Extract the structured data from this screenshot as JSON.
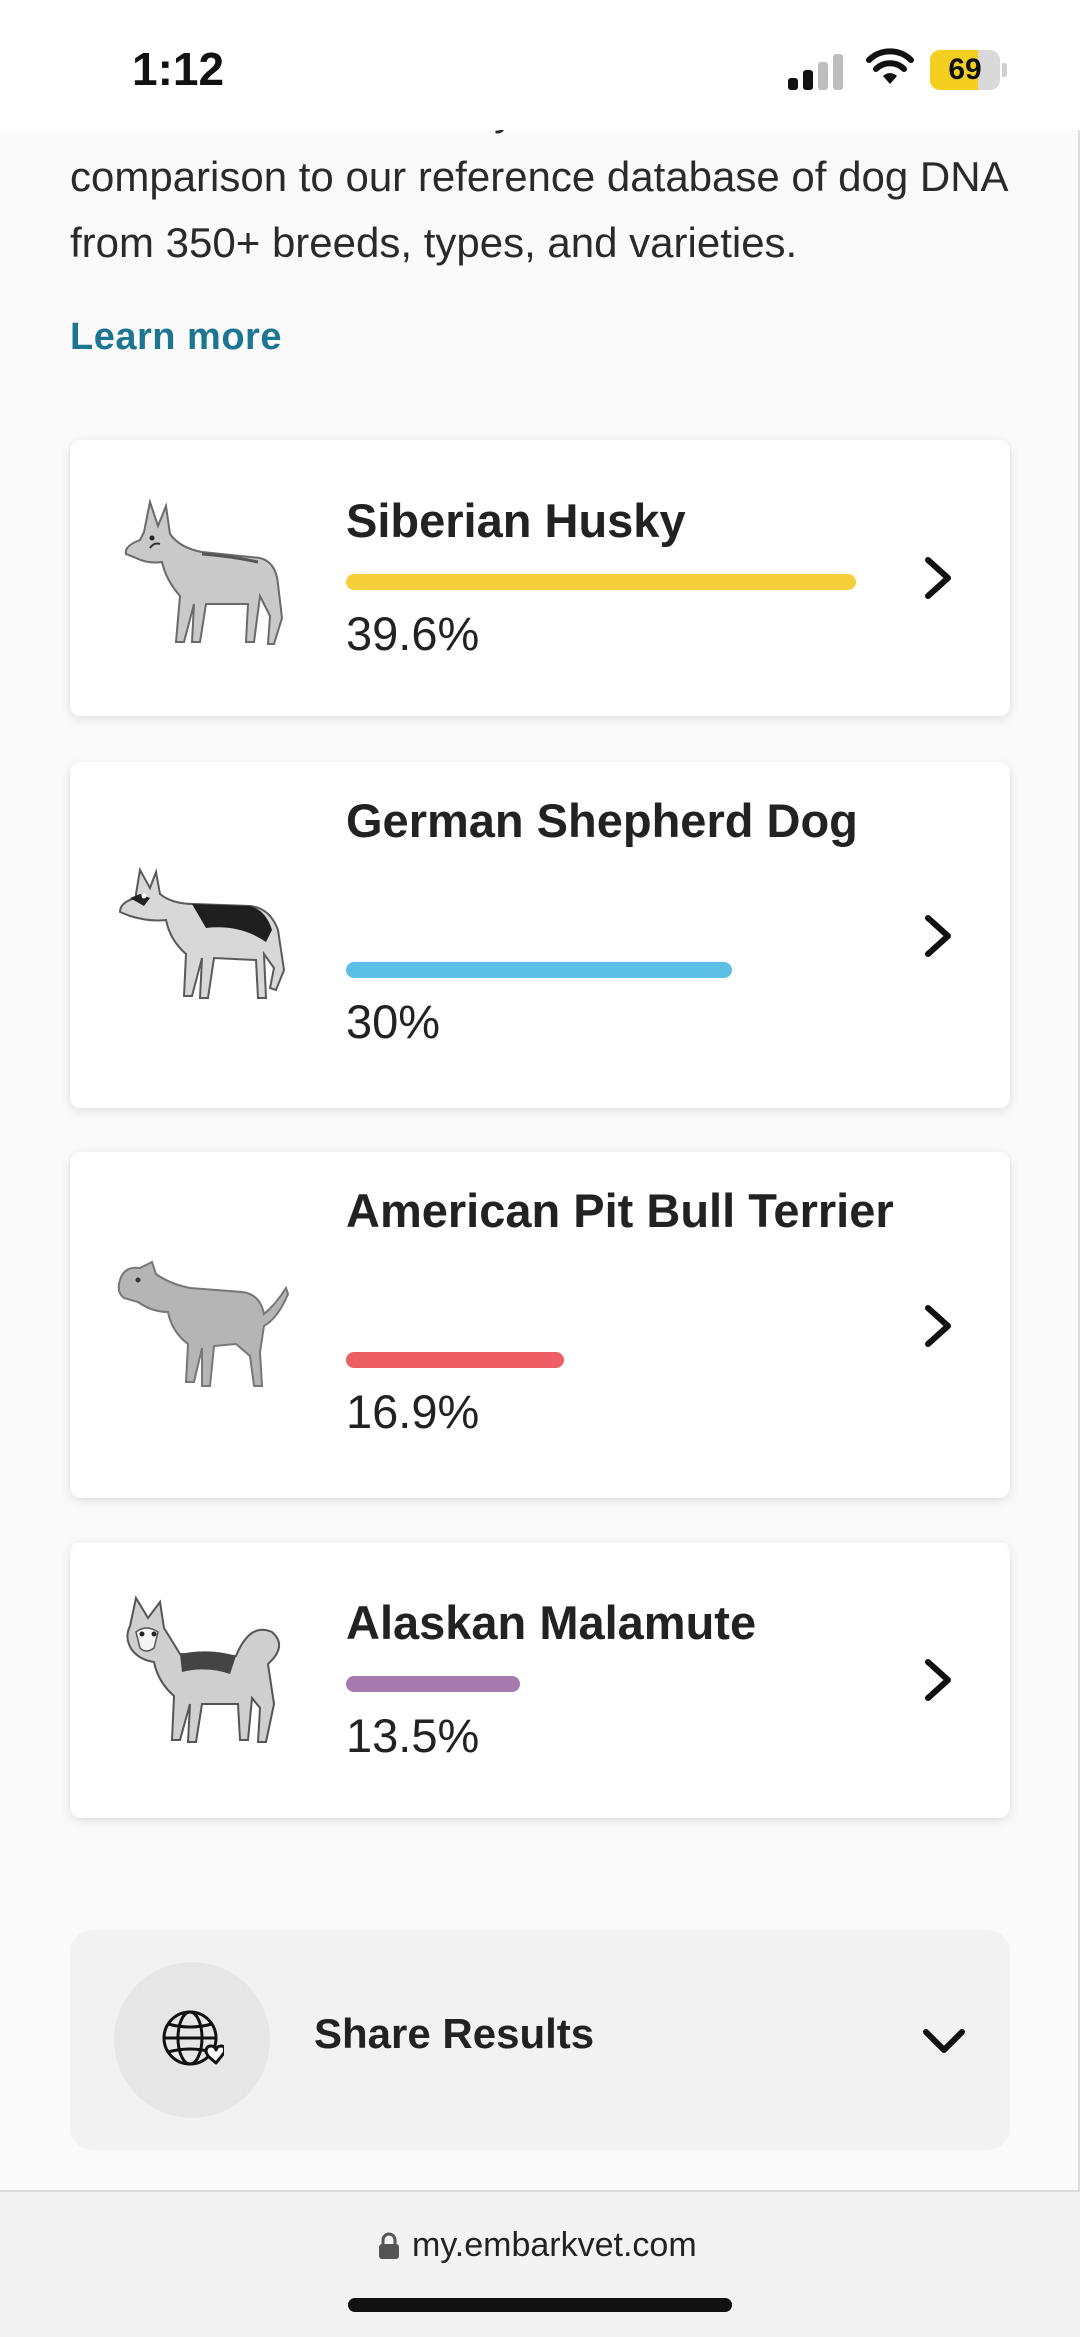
{
  "status_bar": {
    "time": "1:12",
    "battery_level": "69",
    "battery_fraction": 0.69
  },
  "intro": {
    "text": "Nala’s DNA breed analysis is based on a comparison to our reference database of dog DNA from 350+ breeds, types, and varieties.",
    "learn_more": "Learn more"
  },
  "breeds": [
    {
      "name": "Siberian Husky",
      "percent_label": "39.6%",
      "percent": 39.6,
      "color": "#f5cf3a",
      "icon": "husky-illustration"
    },
    {
      "name": "German Shepherd Dog",
      "percent_label": "30%",
      "percent": 30,
      "color": "#5bbfe6",
      "icon": "german-shepherd-illustration"
    },
    {
      "name": "American Pit Bull Terrier",
      "percent_label": "16.9%",
      "percent": 16.9,
      "color": "#ee5f63",
      "icon": "pit-bull-illustration"
    },
    {
      "name": "Alaskan Malamute",
      "percent_label": "13.5%",
      "percent": 13.5,
      "color": "#a77aaf",
      "icon": "malamute-illustration"
    }
  ],
  "share": {
    "label": "Share Results",
    "icon": "globe-heart-icon"
  },
  "browser": {
    "url": "my.embarkvet.com"
  }
}
